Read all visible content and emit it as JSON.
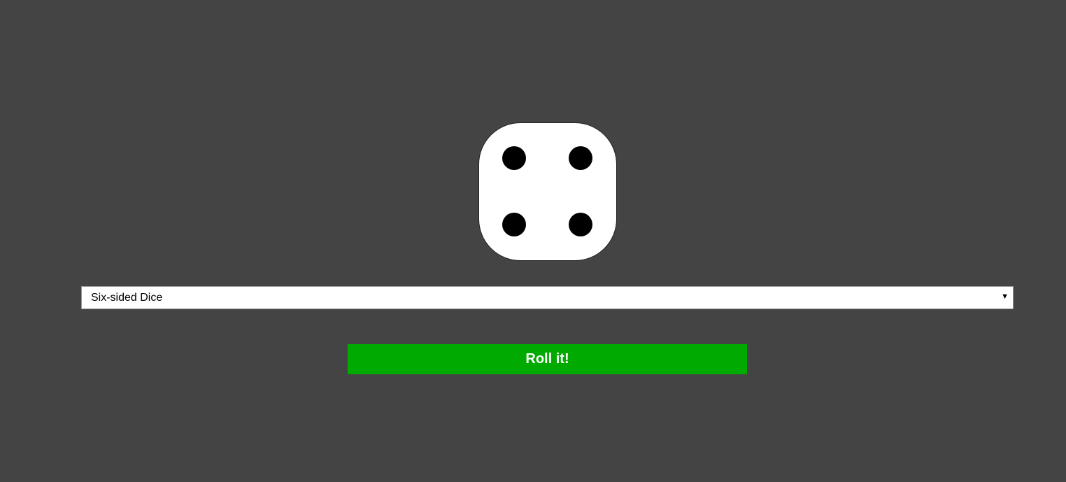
{
  "die": {
    "face_value": 4,
    "pips": [
      "top-left",
      "top-right",
      "bottom-left",
      "bottom-right"
    ]
  },
  "dice_select": {
    "selected_label": "Six-sided Dice",
    "arrow_glyph": "▼"
  },
  "roll_button": {
    "label": "Roll it!",
    "color": "#00aa00"
  },
  "colors": {
    "background": "#444444",
    "die_face": "#ffffff",
    "pip": "#000000"
  }
}
